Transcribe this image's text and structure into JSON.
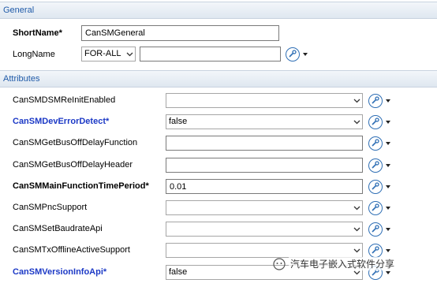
{
  "general": {
    "header": "General",
    "short_name_label": "ShortName*",
    "short_name_value": "CanSMGeneral",
    "long_name_label": "LongName",
    "long_name_lang": "FOR-ALL",
    "long_name_value": ""
  },
  "attributes": {
    "header": "Attributes",
    "rows": [
      {
        "label": "CanSMDSMReInitEnabled",
        "value": "",
        "control": "combo",
        "style": "normal"
      },
      {
        "label": "CanSMDevErrorDetect*",
        "value": "false",
        "control": "combo",
        "style": "blue"
      },
      {
        "label": "CanSMGetBusOffDelayFunction",
        "value": "",
        "control": "text",
        "style": "normal"
      },
      {
        "label": "CanSMGetBusOffDelayHeader",
        "value": "",
        "control": "text",
        "style": "normal"
      },
      {
        "label": "CanSMMainFunctionTimePeriod*",
        "value": "0.01",
        "control": "text",
        "style": "bold"
      },
      {
        "label": "CanSMPncSupport",
        "value": "",
        "control": "combo",
        "style": "normal"
      },
      {
        "label": "CanSMSetBaudrateApi",
        "value": "",
        "control": "combo",
        "style": "normal"
      },
      {
        "label": "CanSMTxOfflineActiveSupport",
        "value": "",
        "control": "combo",
        "style": "normal"
      },
      {
        "label": "CanSMVersionInfoApi*",
        "value": "false",
        "control": "combo",
        "style": "blue"
      }
    ]
  },
  "watermark": {
    "text": "汽车电子嵌入式软件分享"
  },
  "icons": {
    "tool": "wrench-circle-icon",
    "dropdown": "chevron-down-icon"
  },
  "colors": {
    "section_text": "#1f5aa8",
    "required_blue": "#1c39c6",
    "tool_ring": "#2f6fb5"
  }
}
